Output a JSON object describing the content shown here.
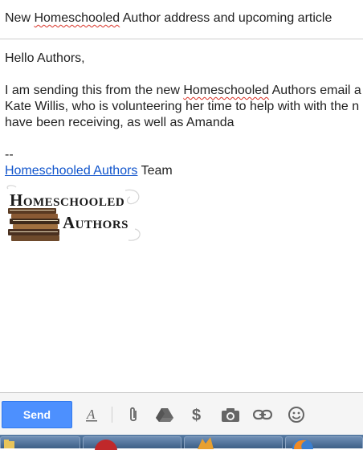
{
  "compose": {
    "subject": {
      "before": "New ",
      "misspelled": "Homeschooled",
      "after": " Author address and upcoming article"
    },
    "body": {
      "greeting": "Hello Authors,",
      "line1_before": "I am sending this from the new ",
      "line1_misspelled": "Homeschooled",
      "line1_after": " Authors email a",
      "line2": "Kate Willis, who is volunteering her time to help with with the n",
      "line3": "have been receiving, as well as Amanda",
      "signature_dash": "--",
      "signature_link": "Homeschooled Authors",
      "signature_rest": " Team"
    },
    "logo": {
      "line1": "Homeschooled",
      "line2": "Authors"
    }
  },
  "toolbar": {
    "send_label": "Send",
    "icons": [
      "format-text-icon",
      "attach-icon",
      "drive-icon",
      "money-icon",
      "camera-icon",
      "link-icon",
      "emoji-icon"
    ]
  },
  "colors": {
    "send_button": "#4d90fe",
    "link": "#1155cc",
    "spellcheck": "#d93025",
    "taskbar": "#3d5f86"
  }
}
